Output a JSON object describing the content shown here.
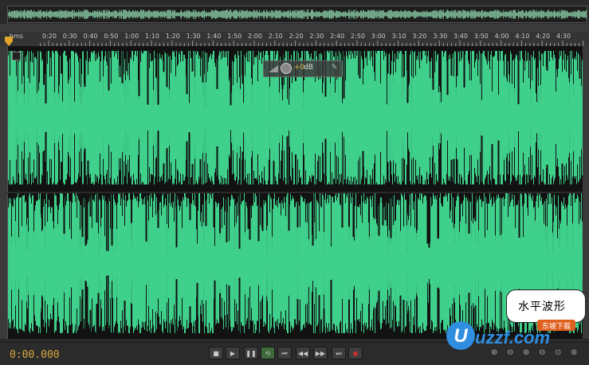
{
  "ruler": {
    "unit_label": "hms",
    "ticks": [
      "0:20",
      "0:30",
      "0:40",
      "0:50",
      "1:00",
      "1:10",
      "1:20",
      "1:30",
      "1:40",
      "1:50",
      "2:00",
      "2:10",
      "2:20",
      "2:30",
      "2:40",
      "2:50",
      "3:00",
      "3:10",
      "3:20",
      "3:30",
      "3:40",
      "3:50",
      "4:00",
      "4:10",
      "4:20",
      "4:30"
    ]
  },
  "hud": {
    "value": "+0",
    "unit": "dB"
  },
  "transport": {
    "time": "0:00.000",
    "buttons": [
      {
        "name": "stop-button",
        "glyph": "■"
      },
      {
        "name": "play-button",
        "glyph": "▶"
      },
      {
        "name": "pause-button",
        "glyph": "❚❚"
      },
      {
        "name": "loop-button",
        "glyph": "⟲"
      },
      {
        "name": "go-to-start-button",
        "glyph": "⏮"
      },
      {
        "name": "rewind-button",
        "glyph": "◀◀"
      },
      {
        "name": "fast-forward-button",
        "glyph": "▶▶"
      },
      {
        "name": "go-to-end-button",
        "glyph": "⏭"
      },
      {
        "name": "record-button",
        "glyph": "●"
      }
    ]
  },
  "caption": {
    "text": "水平波形"
  },
  "logo": {
    "text": "uzzf.com",
    "badge": "东坡下载"
  },
  "colors": {
    "waveform": "#3fd08c",
    "accent": "#d7a83d",
    "record": "#c03030"
  }
}
